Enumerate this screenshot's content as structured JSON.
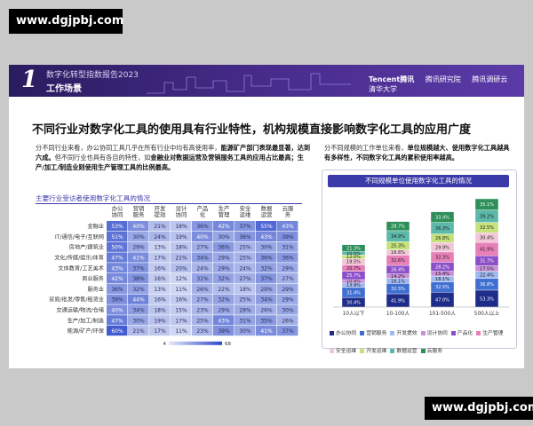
{
  "watermark_top": "www.dgjpbj.com",
  "watermark_bottom": "www.dgjpbj.com",
  "banner": {
    "section_number": "1",
    "report_name": "数字化转型指数报告2023",
    "section_title": "工作场景",
    "brands": [
      "Tencent腾讯",
      "腾讯研究院",
      "腾讯调研云",
      "清华大学"
    ]
  },
  "headline": "不同行业对数字化工具的使用具有行业特性，机构规模直接影响数字化工具的应用广度",
  "para_left": {
    "p1": "分不同行业来看，办公协同工具几乎在所有行业中均有高使用率，",
    "p1_bold": "能源矿产部门表现最显著，达到六成。",
    "p2": "但不同行业也具有各自的特性，如",
    "p2_bold1": "金融业对数据运营及营销服务工具的应用占比最高；",
    "p2_bold2": "生产/加工/制造业则使用生产管理工具的比例最高。"
  },
  "para_right": {
    "p1": "分不同规模的工作单位来看，",
    "p1_bold": "单位规模越大、使用数字化工具越具有多样性，不同数字化工具的累积使用率越高。"
  },
  "heatmap_title": "主要行业受访者使用数字化工具的情况",
  "bar_title": "不同规模单位使用数字化工具的情况",
  "colors": {
    "high": "#2b47c9",
    "low": "#e3e8f8",
    "accent": "#3a37a8"
  },
  "chart_data": [
    {
      "type": "heatmap",
      "title": "主要行业受访者使用数字化工具的情况",
      "columns": [
        "办公协同",
        "营销服务",
        "开发提效",
        "设计协同",
        "产品化",
        "生产管理",
        "安全运维",
        "数据运营",
        "云服务"
      ],
      "rows": [
        "金融业",
        "IT/通信/电子/互联网",
        "房地产/建筑业",
        "文化/传媒/娱乐/体育",
        "文体教育/工艺美术",
        "商业服务",
        "服务业",
        "贸易/批发/零售/租赁业",
        "交通运输/物流/仓储",
        "生产/加工/制造",
        "能源/矿产/环保"
      ],
      "values": [
        [
          53,
          40,
          21,
          18,
          36,
          42,
          37,
          55,
          43
        ],
        [
          51,
          30,
          24,
          19,
          40,
          30,
          36,
          43,
          39
        ],
        [
          50,
          29,
          13,
          18,
          27,
          36,
          25,
          30,
          31
        ],
        [
          47,
          41,
          17,
          21,
          34,
          29,
          25,
          36,
          36
        ],
        [
          43,
          37,
          16,
          20,
          24,
          29,
          24,
          32,
          29
        ],
        [
          42,
          38,
          16,
          12,
          31,
          32,
          27,
          37,
          27
        ],
        [
          36,
          32,
          13,
          11,
          26,
          22,
          18,
          29,
          29
        ],
        [
          39,
          44,
          16,
          16,
          27,
          32,
          25,
          34,
          29
        ],
        [
          40,
          34,
          18,
          15,
          23,
          29,
          28,
          26,
          30
        ],
        [
          47,
          30,
          19,
          17,
          25,
          43,
          31,
          35,
          26
        ],
        [
          60,
          21,
          17,
          11,
          23,
          39,
          30,
          41,
          37
        ]
      ],
      "colorbar": {
        "min": 4,
        "max": 68
      }
    },
    {
      "type": "bar",
      "stacked": true,
      "title": "不同规模单位使用数字化工具的情况",
      "categories": [
        "10人以下",
        "10-100人",
        "101-500人",
        "500人以上"
      ],
      "series": [
        {
          "name": "办公协同",
          "color": "#1f2d8a",
          "values": [
            30.4,
            41.9,
            47.0,
            53.3
          ]
        },
        {
          "name": "营销服务",
          "color": "#3f6fd1",
          "values": [
            31.4,
            32.5,
            32.5,
            36.8
          ]
        },
        {
          "name": "开发提效",
          "color": "#9fb8f0",
          "values": [
            13.9,
            16.1,
            18.1,
            22.4
          ]
        },
        {
          "name": "设计协同",
          "color": "#c98fd8",
          "values": [
            10.9,
            14.2,
            15.4,
            17.5
          ]
        },
        {
          "name": "产品化",
          "color": "#8c4fc9",
          "values": [
            25.7,
            26.4,
            28.2,
            31.7
          ]
        },
        {
          "name": "生产管理",
          "color": "#e77fb8",
          "values": [
            20.7,
            32.6,
            32.3,
            41.9
          ]
        },
        {
          "name": "安全运维",
          "color": "#f3c6d8",
          "values": [
            19.5,
            16.6,
            29.9,
            30.4
          ]
        },
        {
          "name": "开发运维",
          "color": "#c6e27a",
          "values": [
            12.0,
            25.3,
            26.8,
            32.5
          ]
        },
        {
          "name": "数据运营",
          "color": "#5cb8a8",
          "values": [
            10.5,
            34.9,
            36.3,
            39.2
          ]
        },
        {
          "name": "云服务",
          "color": "#2e8f5a",
          "values": [
            21.3,
            28.7,
            33.4,
            35.1
          ]
        }
      ]
    }
  ]
}
